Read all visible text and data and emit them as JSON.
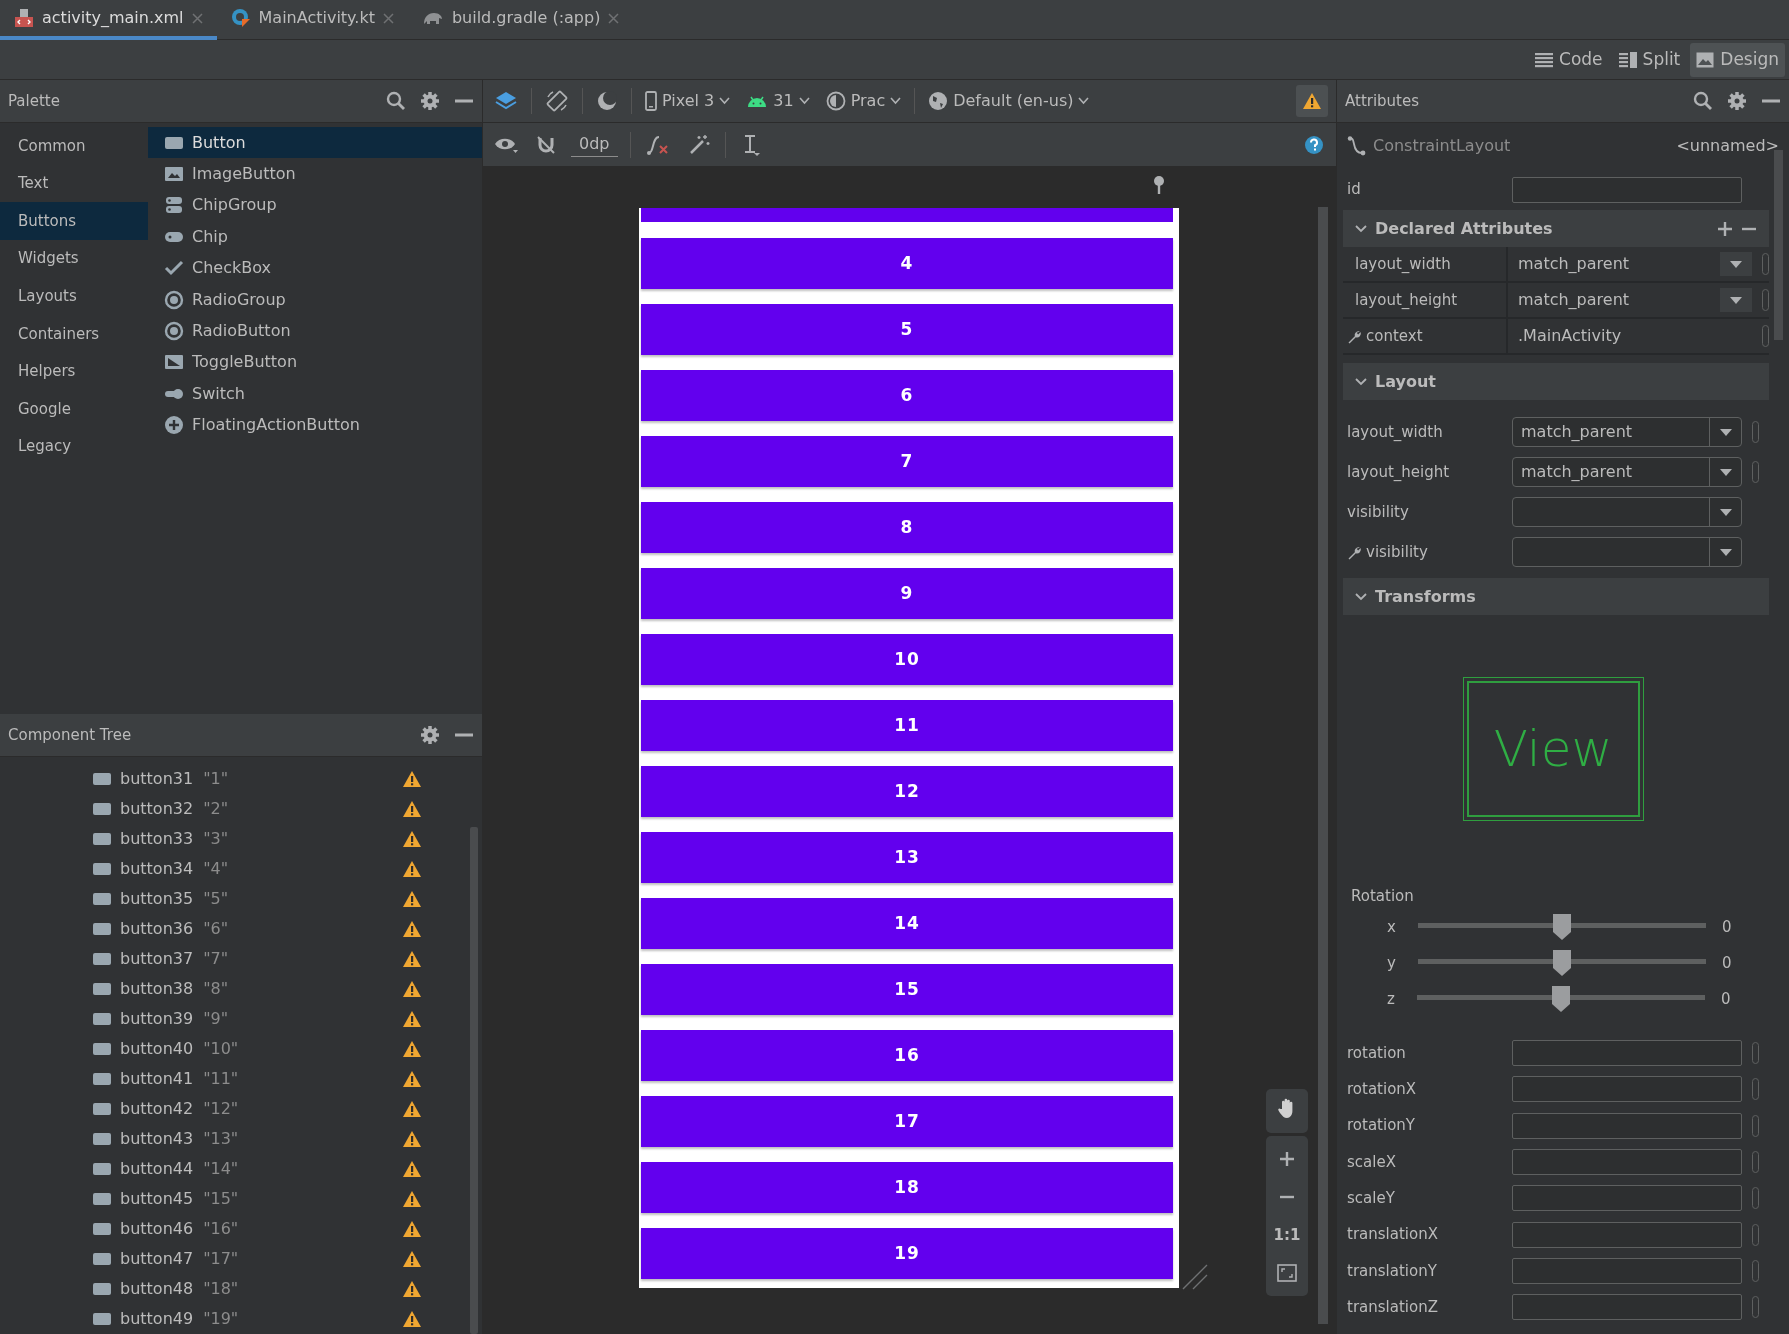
{
  "tabs": [
    {
      "label": "activity_main.xml",
      "selected": true,
      "kind": "xml"
    },
    {
      "label": "MainActivity.kt",
      "selected": false,
      "kind": "kotlin"
    },
    {
      "label": "build.gradle (:app)",
      "selected": false,
      "kind": "gradle"
    }
  ],
  "view_modes": [
    {
      "label": "Code",
      "selected": false,
      "kind": "code"
    },
    {
      "label": "Split",
      "selected": false,
      "kind": "split"
    },
    {
      "label": "Design",
      "selected": true,
      "kind": "design"
    }
  ],
  "palette": {
    "title": "Palette",
    "categories": [
      {
        "label": "Common",
        "selected": false
      },
      {
        "label": "Text",
        "selected": false
      },
      {
        "label": "Buttons",
        "selected": true
      },
      {
        "label": "Widgets",
        "selected": false
      },
      {
        "label": "Layouts",
        "selected": false
      },
      {
        "label": "Containers",
        "selected": false
      },
      {
        "label": "Helpers",
        "selected": false
      },
      {
        "label": "Google",
        "selected": false
      },
      {
        "label": "Legacy",
        "selected": false
      }
    ],
    "items": [
      {
        "label": "Button",
        "selected": true,
        "kind": "button"
      },
      {
        "label": "ImageButton",
        "selected": false,
        "kind": "image"
      },
      {
        "label": "ChipGroup",
        "selected": false,
        "kind": "chipgroup"
      },
      {
        "label": "Chip",
        "selected": false,
        "kind": "chip"
      },
      {
        "label": "CheckBox",
        "selected": false,
        "kind": "check"
      },
      {
        "label": "RadioGroup",
        "selected": false,
        "kind": "radio"
      },
      {
        "label": "RadioButton",
        "selected": false,
        "kind": "radio"
      },
      {
        "label": "ToggleButton",
        "selected": false,
        "kind": "toggle"
      },
      {
        "label": "Switch",
        "selected": false,
        "kind": "switch"
      },
      {
        "label": "FloatingActionButton",
        "selected": false,
        "kind": "fab"
      }
    ]
  },
  "toolbar": {
    "device": "Pixel 3",
    "api": "31",
    "theme": "Prac",
    "locale": "Default (en-us)",
    "margin": "0dp"
  },
  "component_tree": {
    "title": "Component Tree",
    "rows": [
      {
        "id": "button31",
        "text": "\"1\"",
        "warning": true
      },
      {
        "id": "button32",
        "text": "\"2\"",
        "warning": true
      },
      {
        "id": "button33",
        "text": "\"3\"",
        "warning": true
      },
      {
        "id": "button34",
        "text": "\"4\"",
        "warning": true
      },
      {
        "id": "button35",
        "text": "\"5\"",
        "warning": true
      },
      {
        "id": "button36",
        "text": "\"6\"",
        "warning": true
      },
      {
        "id": "button37",
        "text": "\"7\"",
        "warning": true
      },
      {
        "id": "button38",
        "text": "\"8\"",
        "warning": true
      },
      {
        "id": "button39",
        "text": "\"9\"",
        "warning": true
      },
      {
        "id": "button40",
        "text": "\"10\"",
        "warning": true
      },
      {
        "id": "button41",
        "text": "\"11\"",
        "warning": true
      },
      {
        "id": "button42",
        "text": "\"12\"",
        "warning": true
      },
      {
        "id": "button43",
        "text": "\"13\"",
        "warning": true
      },
      {
        "id": "button44",
        "text": "\"14\"",
        "warning": true
      },
      {
        "id": "button45",
        "text": "\"15\"",
        "warning": true
      },
      {
        "id": "button46",
        "text": "\"16\"",
        "warning": true
      },
      {
        "id": "button47",
        "text": "\"17\"",
        "warning": true
      },
      {
        "id": "button48",
        "text": "\"18\"",
        "warning": true
      },
      {
        "id": "button49",
        "text": "\"19\"",
        "warning": true
      }
    ]
  },
  "canvas": {
    "buttons": [
      "4",
      "5",
      "6",
      "7",
      "8",
      "9",
      "10",
      "11",
      "12",
      "13",
      "14",
      "15",
      "16",
      "17",
      "18",
      "19"
    ],
    "zoom_ratio": "1:1"
  },
  "attributes": {
    "title": "Attributes",
    "component": "ConstraintLayout",
    "name": "<unnamed>",
    "id_label": "id",
    "declared": {
      "title": "Declared Attributes",
      "rows": [
        {
          "label": "layout_width",
          "value": "match_parent",
          "kind": "dropdown"
        },
        {
          "label": "layout_height",
          "value": "match_parent",
          "kind": "dropdown"
        },
        {
          "label": "context",
          "value": ".MainActivity",
          "kind": "tool"
        }
      ]
    },
    "layout": {
      "title": "Layout",
      "rows": [
        {
          "label": "layout_width",
          "value": "match_parent",
          "tool": false
        },
        {
          "label": "layout_height",
          "value": "match_parent",
          "tool": false
        },
        {
          "label": "visibility",
          "tool": false
        },
        {
          "label": "visibility",
          "tool": true
        }
      ]
    },
    "transforms": {
      "title": "Transforms",
      "preview": "View",
      "rotation_title": "Rotation",
      "axes": [
        {
          "label": "x",
          "level": 0.5,
          "reading": "0"
        },
        {
          "label": "y",
          "level": 0.5,
          "reading": "0"
        },
        {
          "label": "z",
          "level": 0.5,
          "reading": "0"
        }
      ],
      "fields": [
        "rotation",
        "rotationX",
        "rotationY",
        "scaleX",
        "scaleY",
        "translationX",
        "translationY",
        "translationZ"
      ]
    }
  }
}
